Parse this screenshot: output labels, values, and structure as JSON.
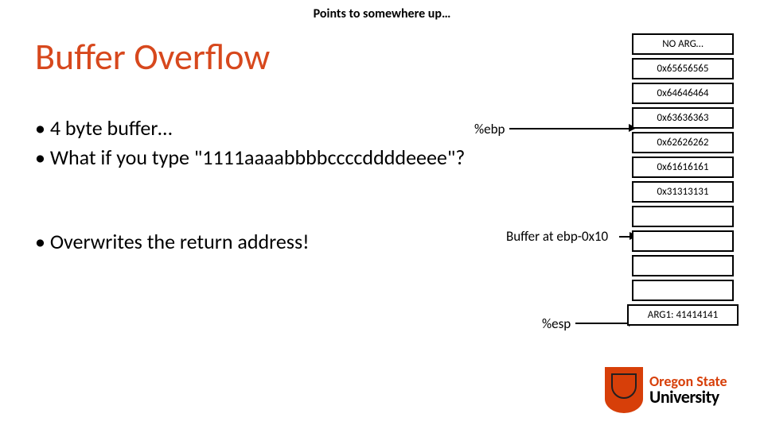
{
  "tophint": "Points to somewhere up…",
  "title": "Buffer Overflow",
  "bullets": {
    "b1": "• 4 byte buffer…",
    "b2": "• What if you type \"1111aaaabbbbccccddddeeee\"?",
    "b3": "• Overwrites the return address!"
  },
  "labels": {
    "ebp": "%ebp",
    "buf": "Buffer at ebp-0x10",
    "esp": "%esp"
  },
  "stack": [
    "NO ARG…",
    "0x65656565",
    "0x64646464",
    "0x63636363",
    "0x62626262",
    "0x61616161",
    "0x31313131",
    "",
    "",
    "",
    "",
    "ARG1: 41414141"
  ],
  "logo": {
    "line1": "Oregon State",
    "line2": "University"
  }
}
